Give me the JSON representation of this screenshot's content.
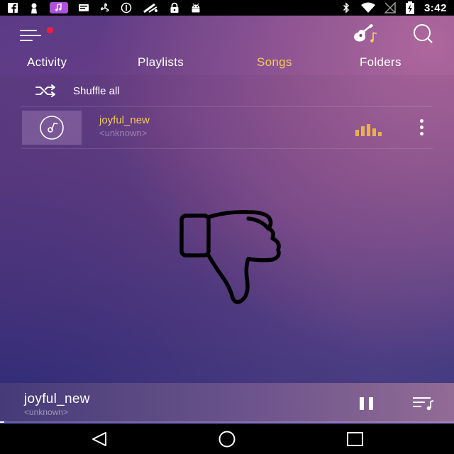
{
  "status_bar": {
    "time": "3:42",
    "left_icons": [
      "facebook-icon",
      "person-notification-icon",
      "music-notification-icon",
      "message-icon",
      "fan-icon",
      "info-icon",
      "fm-radio-icon",
      "lock-icon",
      "android-icon"
    ],
    "right_icons": [
      "bluetooth-icon",
      "wifi-icon",
      "no-signal-icon",
      "battery-charging-icon"
    ]
  },
  "toolbar": {
    "menu_icon": "menu-icon",
    "has_notification": true,
    "guitar_icon": "guitar-music-icon",
    "search_icon": "search-icon"
  },
  "tabs": [
    {
      "label": "Activity",
      "active": false
    },
    {
      "label": "Playlists",
      "active": false
    },
    {
      "label": "Songs",
      "active": true
    },
    {
      "label": "Folders",
      "active": false
    }
  ],
  "shuffle": {
    "icon": "shuffle-icon",
    "label": "Shuffle all"
  },
  "songs": [
    {
      "title": "joyful_new",
      "artist": "<unknown>",
      "playing": true
    }
  ],
  "overlay": {
    "icon": "thumbs-down-icon"
  },
  "now_playing": {
    "title": "joyful_new",
    "artist": "<unknown>",
    "state": "playing",
    "progress": 0.01
  },
  "navigation": [
    "back",
    "home",
    "recents"
  ],
  "colors": {
    "accent": "#f5c85a",
    "equalizer": "#e9b24a",
    "notification_dot": "#ff1a3d"
  }
}
